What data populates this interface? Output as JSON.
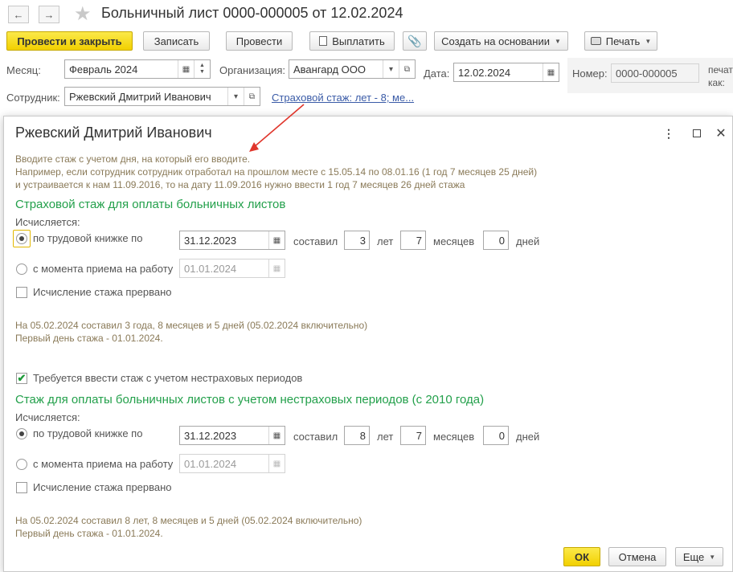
{
  "document": {
    "title": "Больничный лист 0000-000005 от 12.02.2024",
    "toolbar": {
      "post_close": "Провести и закрыть",
      "save": "Записать",
      "post": "Провести",
      "pay": "Выплатить",
      "create_based": "Создать на основании",
      "print": "Печать"
    },
    "fields": {
      "month_label": "Месяц:",
      "month_value": "Февраль 2024",
      "org_label": "Организация:",
      "org_value": "Авангард ООО",
      "date_label": "Дата:",
      "date_value": "12.02.2024",
      "number_label": "Номер:",
      "number_value": "0000-000005",
      "print_as_line1": "печат",
      "print_as_line2": "как:",
      "employee_label": "Сотрудник:",
      "employee_value": "Ржевский Дмитрий Иванович",
      "insurance_link": "Страховой стаж: лет - 8; ме..."
    }
  },
  "modal": {
    "title": "Ржевский Дмитрий Иванович",
    "hint1": "Вводите стаж с учетом дня, на который его вводите.",
    "hint2": "Например, если сотрудник сотрудник отработал на прошлом месте с 15.05.14 по 08.01.16 (1 год 7 месяцев 25 дней)",
    "hint3": "и устраивается к нам 11.09.2016, то на дату 11.09.2016 нужно ввести 1 год 7 месяцев 26 дней стажа",
    "section1": {
      "title": "Страховой стаж для оплаты больничных листов",
      "calc_label": "Исчисляется:",
      "opt_book": "по трудовой книжке по",
      "opt_book_date": "31.12.2023",
      "opt_hire": "с момента приема на работу",
      "opt_hire_date": "01.01.2024",
      "made_label": "составил",
      "years": "3",
      "years_label": "лет",
      "months": "7",
      "months_label": "месяцев",
      "days": "0",
      "days_label": "дней",
      "interrupted": "Исчисление стажа прервано",
      "result1": "На 05.02.2024 составил 3 года, 8 месяцев и 5 дней (05.02.2024 включительно)",
      "result2": "Первый день стажа - 01.01.2024."
    },
    "nonins_check": "Требуется ввести стаж с учетом нестраховых периодов",
    "section2": {
      "title": "Стаж для оплаты больничных листов с учетом нестраховых периодов (с 2010 года)",
      "calc_label": "Исчисляется:",
      "opt_book": "по трудовой книжке по",
      "opt_book_date": "31.12.2023",
      "opt_hire": "с момента приема на работу",
      "opt_hire_date": "01.01.2024",
      "made_label": "составил",
      "years": "8",
      "years_label": "лет",
      "months": "7",
      "months_label": "месяцев",
      "days": "0",
      "days_label": "дней",
      "interrupted": "Исчисление стажа прервано",
      "result1": "На 05.02.2024 составил 8 лет, 8 месяцев и 5 дней (05.02.2024 включительно)",
      "result2": "Первый день стажа - 01.01.2024."
    },
    "buttons": {
      "ok": "ОК",
      "cancel": "Отмена",
      "more": "Еще"
    }
  },
  "colors": {
    "accent_yellow": "#f2d000",
    "section_green": "#23a04b",
    "hint_brown": "#8a7a58",
    "link_blue": "#3a5ba7",
    "arrow_red": "#e0362c"
  }
}
